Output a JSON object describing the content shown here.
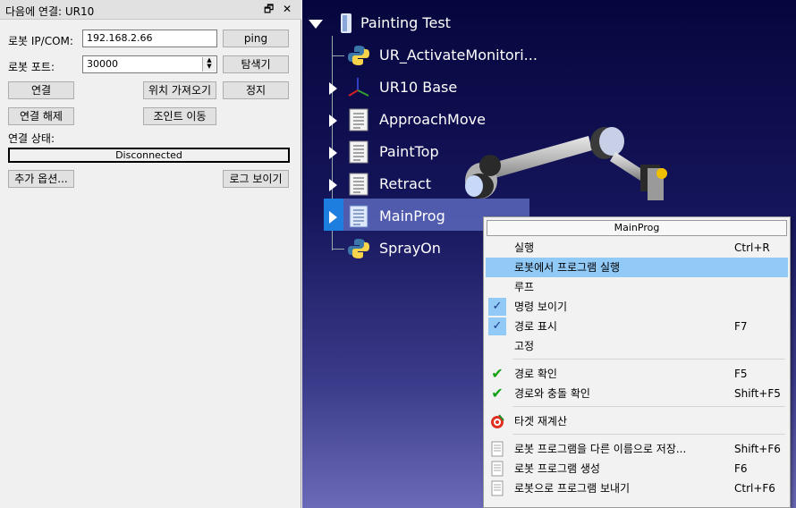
{
  "panel": {
    "title": "다음에 연결: UR10",
    "float_icon": "🗗",
    "close_icon": "✕",
    "ip_label": "로봇 IP/COM:",
    "ip_value": "192.168.2.66",
    "ping_label": "ping",
    "port_label": "로봇 포트:",
    "port_value": "30000",
    "explore_label": "탐색기",
    "connect_label": "연결",
    "get_position_label": "위치 가져오기",
    "stop_label": "정지",
    "disconnect_label": "연결 해제",
    "move_joints_label": "조인트 이동",
    "status_label": "연결 상태:",
    "status_value": "Disconnected",
    "more_options_label": "추가 옵션...",
    "show_log_label": "로그 보이기"
  },
  "tree": {
    "root": "Painting Test",
    "items": [
      {
        "label": "UR_ActivateMonitori...",
        "icon": "python-icon"
      },
      {
        "label": "UR10 Base",
        "icon": "frame-icon"
      },
      {
        "label": "ApproachMove",
        "icon": "program-icon"
      },
      {
        "label": "PaintTop",
        "icon": "program-icon"
      },
      {
        "label": "Retract",
        "icon": "program-icon"
      },
      {
        "label": "MainProg",
        "icon": "program-icon"
      },
      {
        "label": "SprayOn",
        "icon": "python-icon"
      }
    ]
  },
  "menu": {
    "header": "MainProg",
    "items": [
      {
        "label": "실행",
        "shortcut": "Ctrl+R"
      },
      {
        "label": "로봇에서 프로그램 실행",
        "shortcut": ""
      },
      {
        "label": "루프",
        "shortcut": ""
      },
      {
        "label": "명령 보이기",
        "shortcut": ""
      },
      {
        "label": "경로 표시",
        "shortcut": "F7"
      },
      {
        "label": "고정",
        "shortcut": ""
      },
      {
        "label": "경로 확인",
        "shortcut": "F5"
      },
      {
        "label": "경로와 충돌 확인",
        "shortcut": "Shift+F5"
      },
      {
        "label": "타겟 재계산",
        "shortcut": ""
      },
      {
        "label": "로봇 프로그램을 다른 이름으로 저장...",
        "shortcut": "Shift+F6"
      },
      {
        "label": "로봇 프로그램 생성",
        "shortcut": "F6"
      },
      {
        "label": "로봇으로 프로그램 보내기",
        "shortcut": "Ctrl+F6"
      }
    ]
  },
  "colors": {
    "menu_highlight": "#91c9f7",
    "tree_selection": "#5a6ab4",
    "check_green": "#14a014"
  }
}
